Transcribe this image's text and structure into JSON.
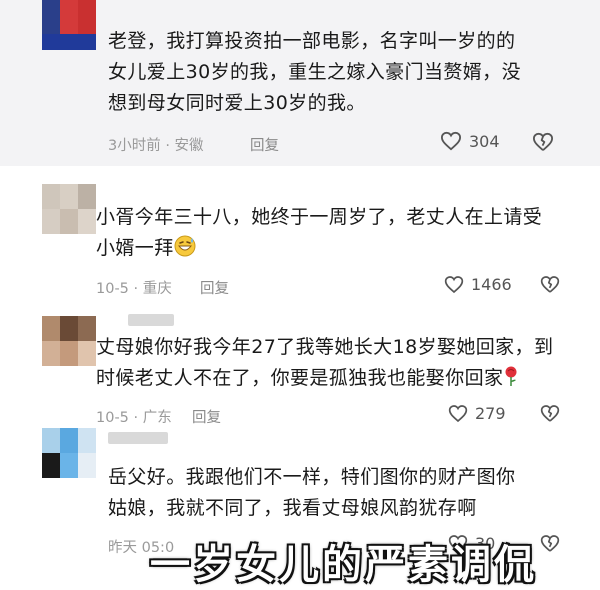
{
  "comments": [
    {
      "lines": [
        "老登，我打算投资拍一部电影，名字叫一岁的的",
        "女儿爱上30岁的我，重生之嫁入豪门当赘婿，没",
        "想到母女同时爱上30岁的我。"
      ],
      "meta": "3小时前 · 安徽",
      "reply": "回复",
      "likes": "304"
    },
    {
      "lines": [
        "小胥今年三十八，她终于一周岁了，老丈人在上请受",
        "小婿一拜"
      ],
      "meta": "10-5 · 重庆",
      "reply": "回复",
      "likes": "1466"
    },
    {
      "lines": [
        "丈母娘你好我今年27了我等她长大18岁娶她回家，到",
        "时候老丈人不在了，你要是孤独我也能娶你回家"
      ],
      "meta": "10-5 · 广东",
      "reply": "回复",
      "likes": "279"
    },
    {
      "lines": [
        "岳父好。我跟他们不一样，特们图你的财产图你",
        "姑娘，我就不同了，我看丈母娘风韵犹存啊"
      ],
      "meta": "昨天 05:0",
      "reply": "",
      "likes": "30"
    }
  ],
  "subtitle": "一岁女儿的严素调侃",
  "icons": {
    "like": "heart-outline-icon",
    "dislike": "broken-heart-icon",
    "emoji_grin": "grinning-sweat-emoji",
    "emoji_rose": "rose-emoji"
  },
  "colors": {
    "highlight_bg": "#f3f3f5",
    "meta_gray": "#9a9a9a",
    "text": "#1a1a1a"
  }
}
